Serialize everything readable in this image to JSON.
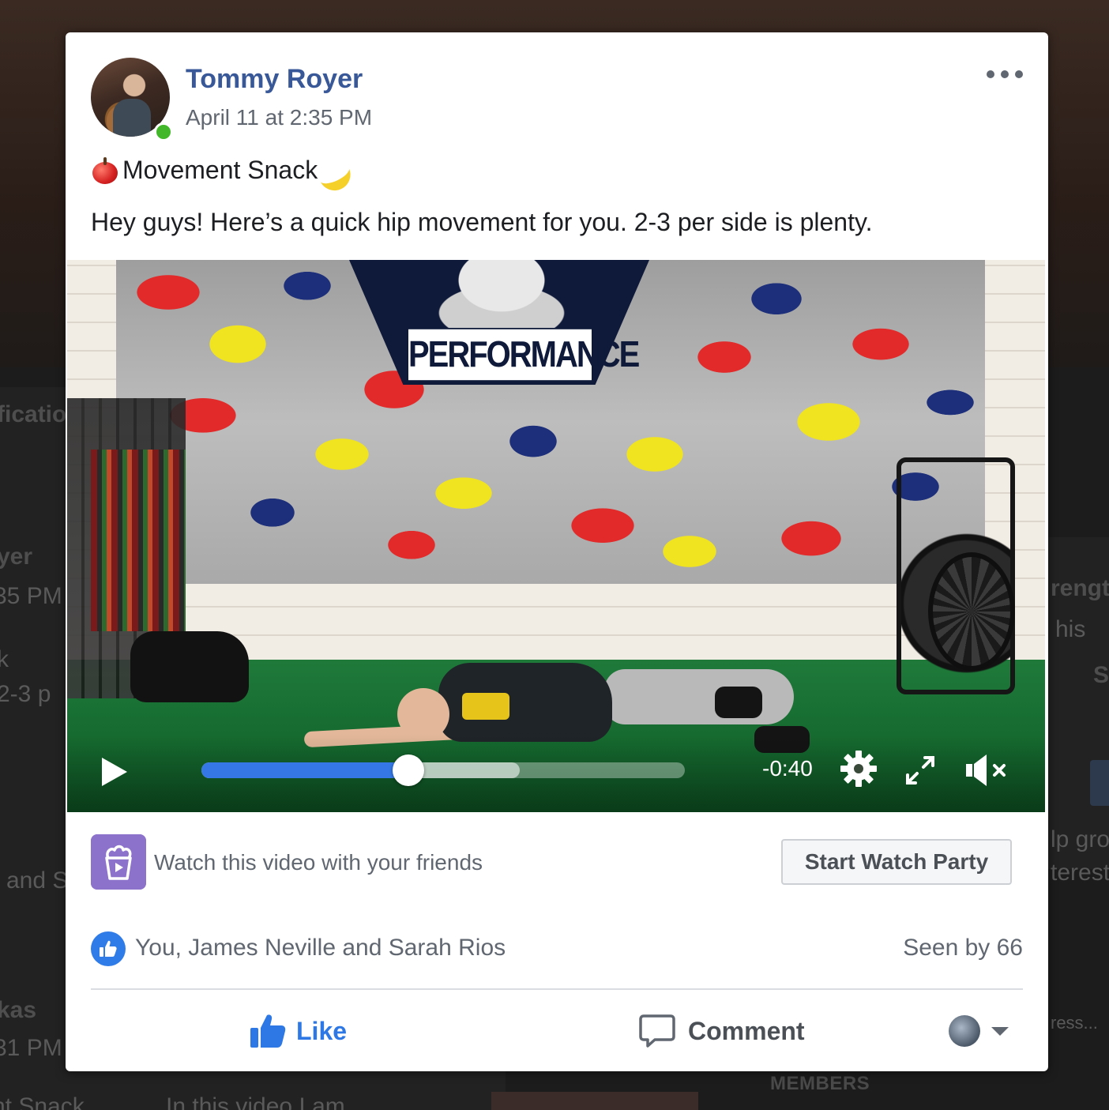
{
  "background": {
    "left_texts": [
      "ficatio",
      "yer",
      "35 PM",
      "k",
      "2-3 p",
      "and S",
      "kas",
      "31 PM",
      "nt Snack",
      "In this video I am"
    ],
    "right_texts": [
      "rengt",
      "his",
      "S",
      "lp gro",
      "terest",
      "ress..."
    ],
    "members_label": "MEMBERS"
  },
  "post": {
    "author": "Tommy Royer",
    "timestamp": "April 11 at 2:35 PM",
    "title": "Movement Snack",
    "body": "Hey guys! Here’s a quick hip movement for you. 2-3 per side is plenty.",
    "more_icon": "more-horizontal-icon",
    "online_status_color": "#42b72a",
    "author_color": "#385898"
  },
  "video": {
    "mural_text": "PERFORMANCE",
    "time_remaining": "-0:40",
    "progress_played": 0.428,
    "progress_buffered": 0.658,
    "accent_color": "#3578e5",
    "icons": [
      "play-icon",
      "settings-gear-icon",
      "fullscreen-icon",
      "muted-speaker-icon"
    ]
  },
  "watch_party": {
    "prompt": "Watch this video with your friends",
    "button_label": "Start Watch Party",
    "icon": "watch-party-popcorn-icon",
    "icon_color": "#8c72cb"
  },
  "reactions": {
    "names": "You, James Neville and Sarah Rios",
    "seen_by": "Seen by 66",
    "reaction_icon": "like-thumb-icon"
  },
  "actions": {
    "like_label": "Like",
    "comment_label": "Comment",
    "like_color": "#2d78e5"
  }
}
